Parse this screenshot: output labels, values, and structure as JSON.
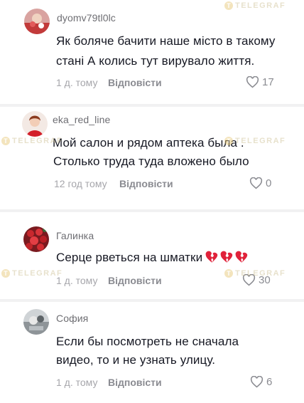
{
  "watermark": "TELEGRAF",
  "reply_label": "Відповісти",
  "comments": [
    {
      "username": "dyomv79tl0lc",
      "lines": [
        "Як боляче бачити наше місто в такому",
        "стані А колись тут вирувало життя."
      ],
      "time": "1 д. тому",
      "likes": "17"
    },
    {
      "username": "eka_red_line",
      "lines": [
        "Мой салон и рядом аптека была .",
        "Столько труда туда вложено было"
      ],
      "time": "12 год тому",
      "likes": "0"
    },
    {
      "username": "Галинка",
      "lines": [
        "Серце рветься на шматки"
      ],
      "emoji": "broken-heart",
      "time": "1 д. тому",
      "likes": "30"
    },
    {
      "username": "София",
      "lines": [
        "Если бы посмотреть не сначала",
        "видео, то и не узнать улицу."
      ],
      "time": "1 д. тому",
      "likes": "6"
    }
  ],
  "colors": {
    "text": "#161823",
    "meta": "#a6a6ab",
    "separator": "#f1f1f2",
    "broken_heart": "#e0223a"
  }
}
